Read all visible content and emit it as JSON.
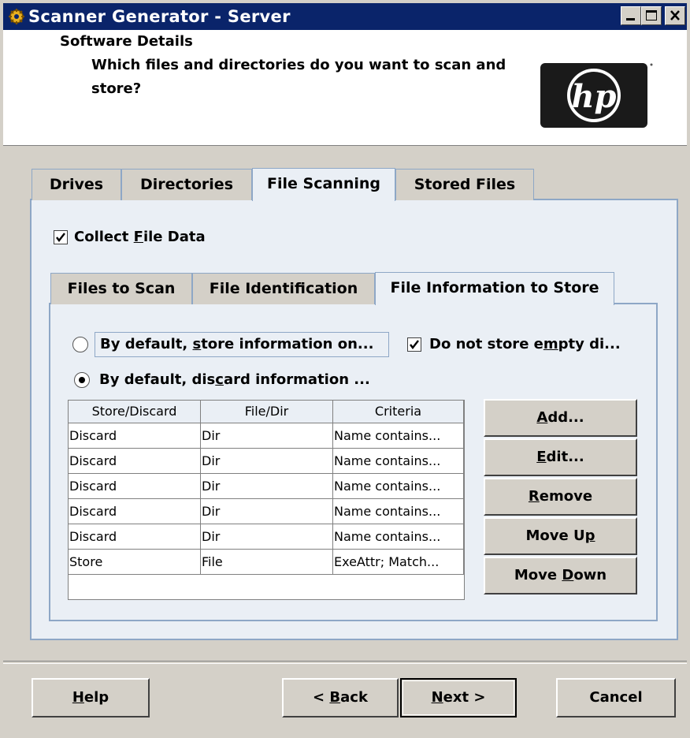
{
  "window": {
    "title": "Scanner Generator - Server",
    "controls": [
      "minimize-icon",
      "maximize-icon",
      "close-icon"
    ],
    "title_bar_color": "#0a246a"
  },
  "header": {
    "title": "Software Details",
    "subtitle": "Which files and directories do you want to scan and store?",
    "logo": "hp"
  },
  "main_tabs": [
    {
      "label": "Drives",
      "selected": false
    },
    {
      "label": "Directories",
      "selected": false
    },
    {
      "label": "File Scanning",
      "selected": true
    },
    {
      "label": "Stored Files",
      "selected": false
    }
  ],
  "collect_file_data": {
    "pre": "Collect ",
    "mnemonic": "F",
    "post": "ile Data",
    "checked": true
  },
  "sub_tabs": [
    {
      "label": "Files to Scan",
      "selected": false
    },
    {
      "label": "File Identification",
      "selected": false
    },
    {
      "label": "File Information to Store",
      "selected": true
    }
  ],
  "options": {
    "store_default": {
      "pre": "By default, ",
      "mnemonic": "s",
      "post": "tore information on...",
      "selected": false
    },
    "discard_default": {
      "pre": "By default, dis",
      "mnemonic": "c",
      "post": "ard information ...",
      "selected": true
    },
    "no_empty_dirs": {
      "pre": "Do not store e",
      "mnemonic": "m",
      "post": "pty di...",
      "checked": true
    }
  },
  "table": {
    "columns": [
      "Store/Discard",
      "File/Dir",
      "Criteria"
    ],
    "rows": [
      [
        "Discard",
        "Dir",
        "Name contains..."
      ],
      [
        "Discard",
        "Dir",
        "Name contains..."
      ],
      [
        "Discard",
        "Dir",
        "Name contains..."
      ],
      [
        "Discard",
        "Dir",
        "Name contains..."
      ],
      [
        "Discard",
        "Dir",
        "Name contains..."
      ],
      [
        "Store",
        "File",
        "ExeAttr; Match..."
      ]
    ]
  },
  "side_buttons": {
    "add": {
      "pre": "",
      "mnemonic": "A",
      "post": "dd..."
    },
    "edit": {
      "pre": "",
      "mnemonic": "E",
      "post": "dit..."
    },
    "remove": {
      "pre": "",
      "mnemonic": "R",
      "post": "emove"
    },
    "move_up": {
      "pre": "Move U",
      "mnemonic": "p",
      "post": ""
    },
    "move_down": {
      "pre": "Move ",
      "mnemonic": "D",
      "post": "own"
    }
  },
  "bottom_buttons": {
    "help": {
      "pre": "",
      "mnemonic": "H",
      "post": "elp"
    },
    "back": {
      "pre": "< ",
      "mnemonic": "B",
      "post": "ack"
    },
    "next": {
      "pre": "",
      "mnemonic": "N",
      "post": "ext >"
    },
    "cancel": {
      "pre": "Cancel",
      "mnemonic": "",
      "post": ""
    }
  },
  "colors": {
    "panel": "#eaeff5",
    "tab_border": "#8ea7c6",
    "dialog": "#d4d0c8"
  }
}
